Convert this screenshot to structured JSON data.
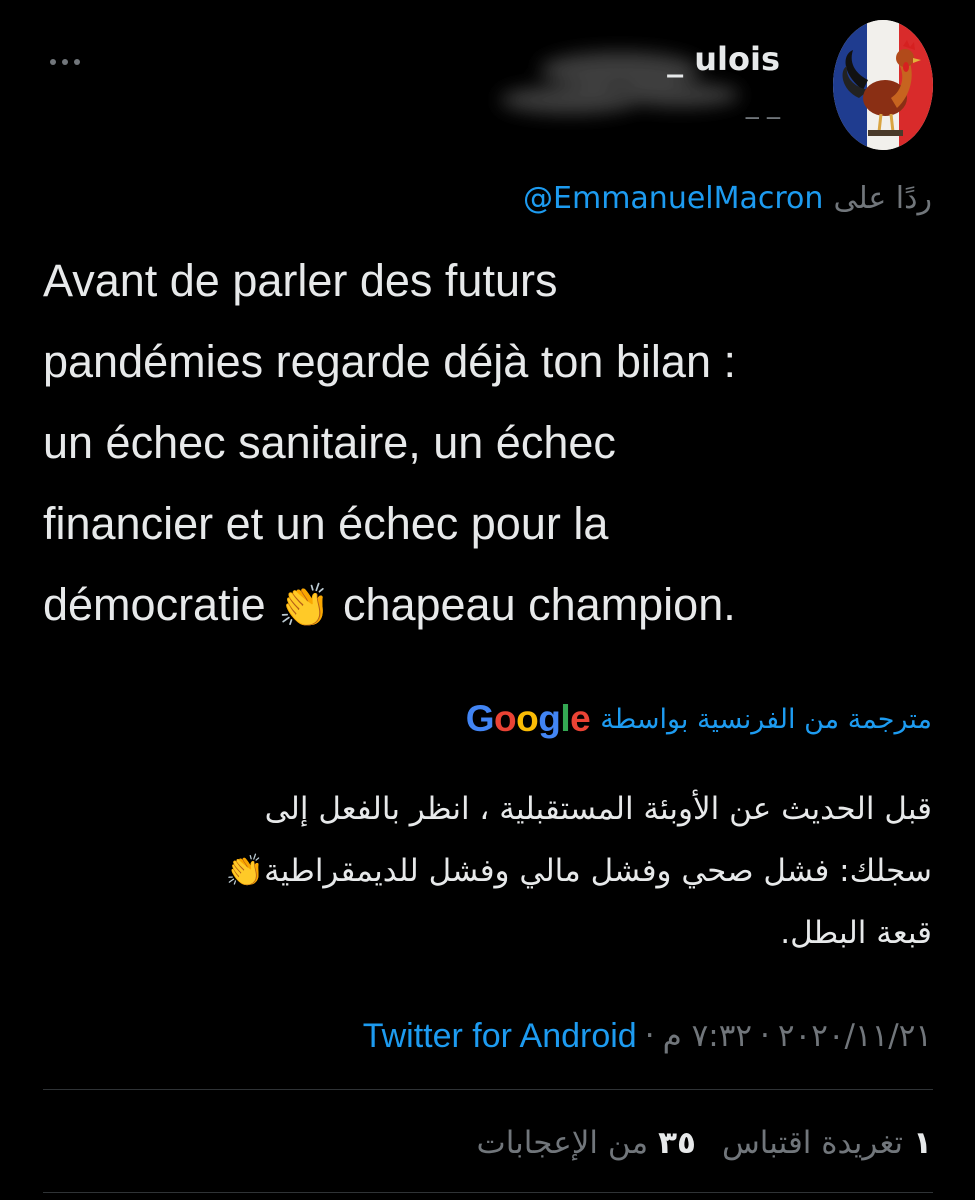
{
  "header": {
    "display_name": "_ ulois",
    "handle": "_   _",
    "more_label": "···"
  },
  "reply": {
    "prefix": "ردًا على",
    "handle": "@EmmanuelMacron"
  },
  "tweet": {
    "lines": [
      "Avant de parler des futurs",
      "pandémies regarde déjà ton bilan :",
      "un échec sanitaire, un échec",
      "financier et un échec pour la",
      "démocratie"
    ],
    "emoji": "👏",
    "line5_end": "chapeau champion."
  },
  "translation": {
    "label": "مترجمة من الفرنسية بواسطة",
    "provider": [
      "G",
      "o",
      "o",
      "g",
      "l",
      "e"
    ],
    "provider_colors": [
      "#4285F4",
      "#EA4335",
      "#FBBC05",
      "#4285F4",
      "#34A853",
      "#EA4335"
    ],
    "lines": [
      "قبل الحديث عن الأوبئة المستقبلية ، انظر بالفعل إلى",
      "سجلك: فشل صحي وفشل مالي وفشل للديمقراطية👏",
      "قبعة البطل."
    ]
  },
  "meta": {
    "date": "٢٠٢٠/١١/٢١",
    "time": "٧:٣٢ م",
    "separator": "·",
    "source": "Twitter for Android"
  },
  "stats": {
    "retweets_count": "١",
    "retweets_label": "تغريدة اقتباس",
    "likes_count": "٣٥",
    "likes_label": "من الإعجابات"
  },
  "colors": {
    "background": "#000000",
    "text": "#e7e9ea",
    "secondary": "#71767b",
    "accent": "#1d9bf0",
    "divider": "#2f3336"
  }
}
